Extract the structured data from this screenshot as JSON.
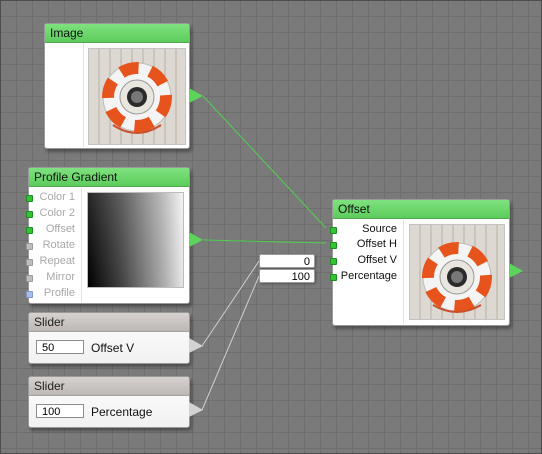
{
  "nodes": {
    "image": {
      "title": "Image"
    },
    "profile_gradient": {
      "title": "Profile Gradient",
      "ports": [
        {
          "label": "Color 1",
          "state": "connected"
        },
        {
          "label": "Color 2",
          "state": "connected"
        },
        {
          "label": "Offset",
          "state": "connected"
        },
        {
          "label": "Rotate",
          "state": "idle"
        },
        {
          "label": "Repeat",
          "state": "idle"
        },
        {
          "label": "Mirror",
          "state": "idle"
        },
        {
          "label": "Profile",
          "state": "profile"
        }
      ]
    },
    "slider_offset_v": {
      "title": "Slider",
      "value": "50",
      "label": "Offset V"
    },
    "slider_percentage": {
      "title": "Slider",
      "value": "100",
      "label": "Percentage"
    },
    "offset": {
      "title": "Offset",
      "ports": [
        {
          "label": "Source"
        },
        {
          "label": "Offset H"
        },
        {
          "label": "Offset V"
        },
        {
          "label": "Percentage"
        }
      ]
    }
  },
  "value_boxes": {
    "offset_v": "0",
    "percentage": "100"
  },
  "icons": {
    "thumbnail": "lifebuoy-photo",
    "output": "output-arrow-icon"
  },
  "colors": {
    "header_active": "#6cd66c",
    "header_slider": "#c9c5c2",
    "wire": "#4fd14f",
    "wire_gray": "#c8c8c8"
  }
}
